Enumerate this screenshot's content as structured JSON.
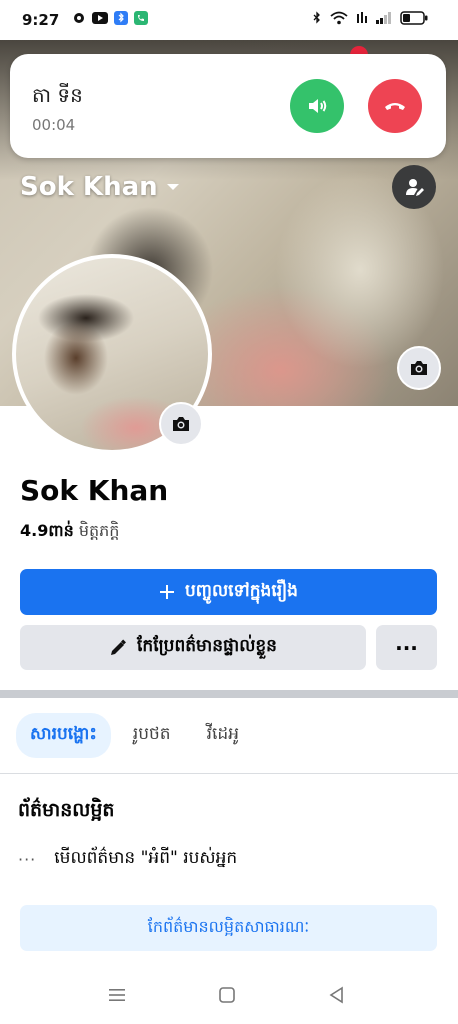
{
  "status_bar": {
    "time": "9:27",
    "left_icons": [
      "settings-icon",
      "youtube-icon",
      "bluetooth-app-icon",
      "phone-app-icon"
    ],
    "right_icons": [
      "bluetooth-icon",
      "wifi-icon",
      "volte-icon",
      "signal-icon",
      "battery-icon"
    ]
  },
  "call_banner": {
    "caller_name": "តា ទីន",
    "duration": "00:04",
    "accept_color": "#34c26b",
    "hangup_color": "#ee4453"
  },
  "profile": {
    "header_name": "Sok Khan",
    "display_name": "Sok Khan",
    "friends_count": "4.9ពាន់",
    "friends_label": "មិត្តភក្តិ"
  },
  "actions": {
    "add_story": "បញ្ចូលទៅក្នុងរឿង",
    "edit_profile": "កែប្រែពត៌មានផ្ទាល់ខ្លួន",
    "more": "···"
  },
  "tabs": [
    {
      "label": "សារបង្ហោះ",
      "active": true
    },
    {
      "label": "រូបថត",
      "active": false
    },
    {
      "label": "វីដេអូ",
      "active": false
    }
  ],
  "details": {
    "title": "ព័ត៌មានលម្អិត",
    "about_prefix": "···",
    "about_text": "មើលព័ត៌មាន \"អំពី\" របស់អ្នក",
    "edit_public_button": "កែព័ត៌មានលម្អិតសាធារណៈ"
  },
  "colors": {
    "accent": "#1a73f0",
    "light_accent": "#e7f3ff",
    "button_gray": "#e4e6eb"
  }
}
